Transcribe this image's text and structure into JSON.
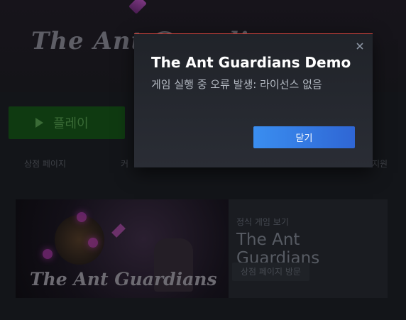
{
  "background": {
    "game_logo": "The Ant Guardians",
    "play_button_label": "플레이",
    "tabs": [
      "상점 페이지",
      "커",
      "지원"
    ],
    "promo": {
      "kicker": "정식 게임 보기",
      "title": "The Ant Guardians",
      "store_button": "상점 페이지 방문",
      "image_logo": "The Ant Guardians"
    }
  },
  "dialog": {
    "title": "The Ant Guardians Demo",
    "message": "게임 실행 중 오류 발생: 라이선스 없음",
    "close_button": "닫기",
    "accent_color": "#c0403a",
    "button_color": "#3a8ef0"
  }
}
